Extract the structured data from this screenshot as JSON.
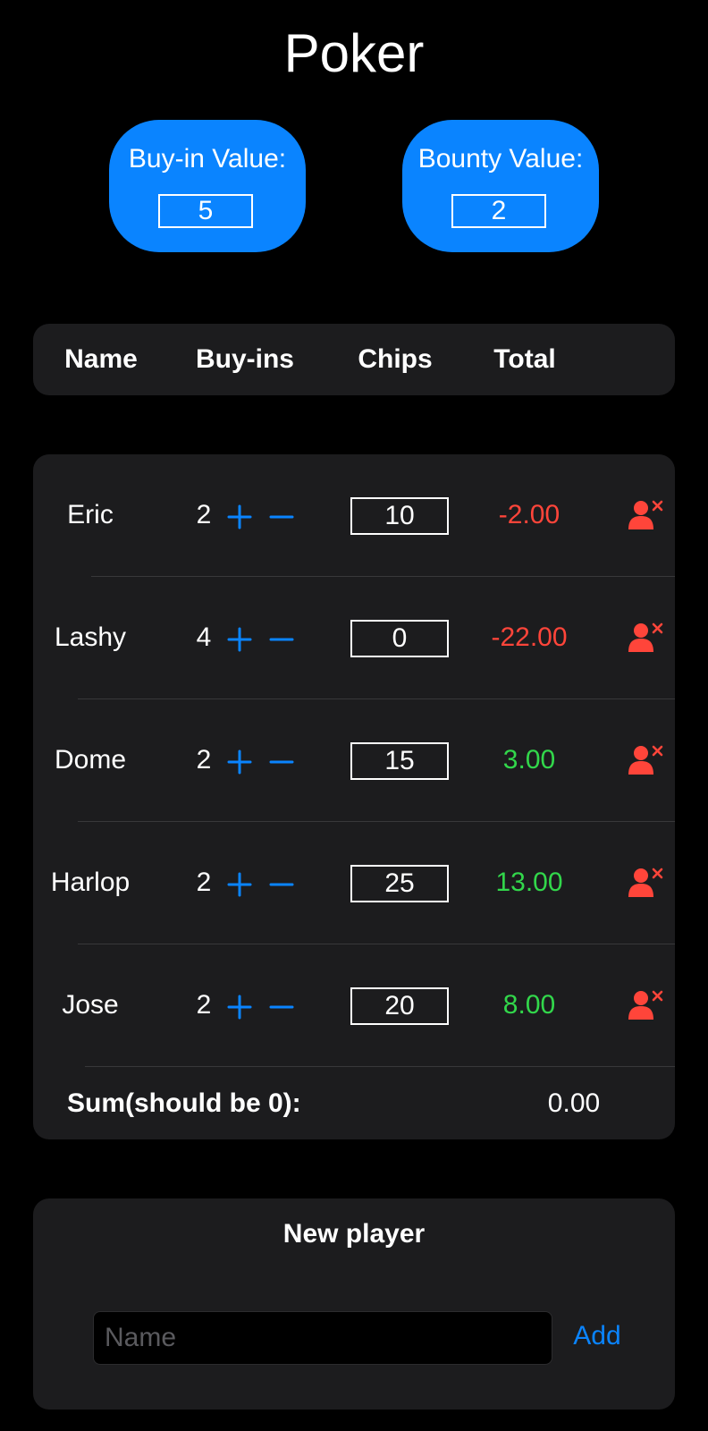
{
  "app": {
    "title": "Poker"
  },
  "settings": {
    "buyin_label": "Buy-in Value:",
    "buyin_value": "5",
    "bounty_label": "Bounty Value:",
    "bounty_value": "2"
  },
  "table_header": {
    "name": "Name",
    "buyins": "Buy-ins",
    "chips": "Chips",
    "total": "Total"
  },
  "players": [
    {
      "name": "Eric",
      "buyins": "2",
      "chips": "10",
      "total": "-2.00",
      "total_color": "#ff453a"
    },
    {
      "name": "Lashy",
      "buyins": "4",
      "chips": "0",
      "total": "-22.00",
      "total_color": "#ff453a"
    },
    {
      "name": "Dome",
      "buyins": "2",
      "chips": "15",
      "total": "3.00",
      "total_color": "#32d74b"
    },
    {
      "name": "Harlop",
      "buyins": "2",
      "chips": "25",
      "total": "13.00",
      "total_color": "#32d74b"
    },
    {
      "name": "Jose",
      "buyins": "2",
      "chips": "20",
      "total": "8.00",
      "total_color": "#32d74b"
    }
  ],
  "icons": {
    "increment": "plus-icon",
    "decrement": "minus-icon",
    "remove_player": "person-remove-icon"
  },
  "summary": {
    "label": "Sum(should be 0):",
    "value": "0.00"
  },
  "new_player": {
    "title": "New player",
    "placeholder": "Name",
    "value": "",
    "add_label": "Add"
  },
  "colors": {
    "background": "#000000",
    "panel": "#1c1c1e",
    "accent": "#0a84ff",
    "negative": "#ff453a",
    "positive": "#32d74b"
  }
}
